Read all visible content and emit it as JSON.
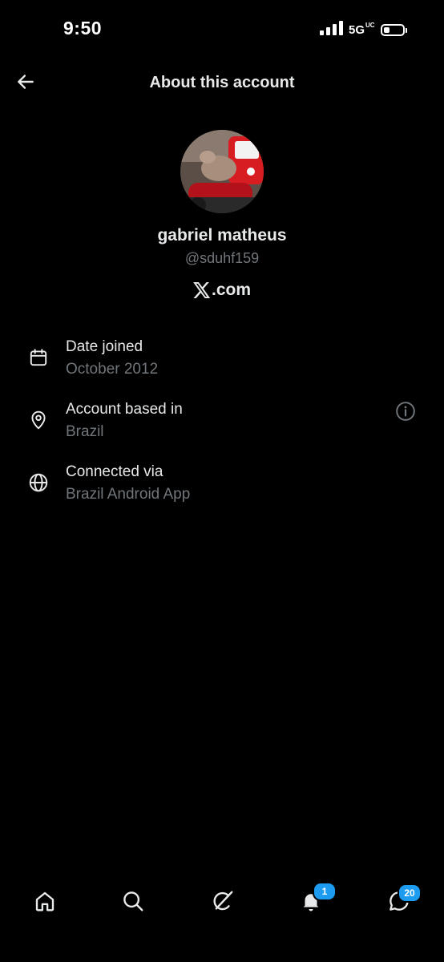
{
  "status_bar": {
    "time": "9:50",
    "network": "5G",
    "network_sup": "UC",
    "battery_level": 0.3
  },
  "header": {
    "title": "About this account"
  },
  "profile": {
    "display_name": "gabriel matheus",
    "handle": "@sduhf159",
    "site": ".com"
  },
  "info": [
    {
      "label": "Date joined",
      "value": "October 2012",
      "icon": "calendar-icon"
    },
    {
      "label": "Account based in",
      "value": "Brazil",
      "icon": "location-pin-icon"
    },
    {
      "label": "Connected via",
      "value": "Brazil Android App",
      "icon": "globe-icon"
    }
  ],
  "bottom_nav": {
    "items": [
      "home-icon",
      "search-icon",
      "grok-icon",
      "bell-icon",
      "messages-icon"
    ],
    "notifications_badge": "1",
    "messages_badge": "20"
  },
  "colors": {
    "background": "#000000",
    "text_primary": "#e7e9ea",
    "text_secondary": "#71767b",
    "accent": "#1d9bf0"
  }
}
